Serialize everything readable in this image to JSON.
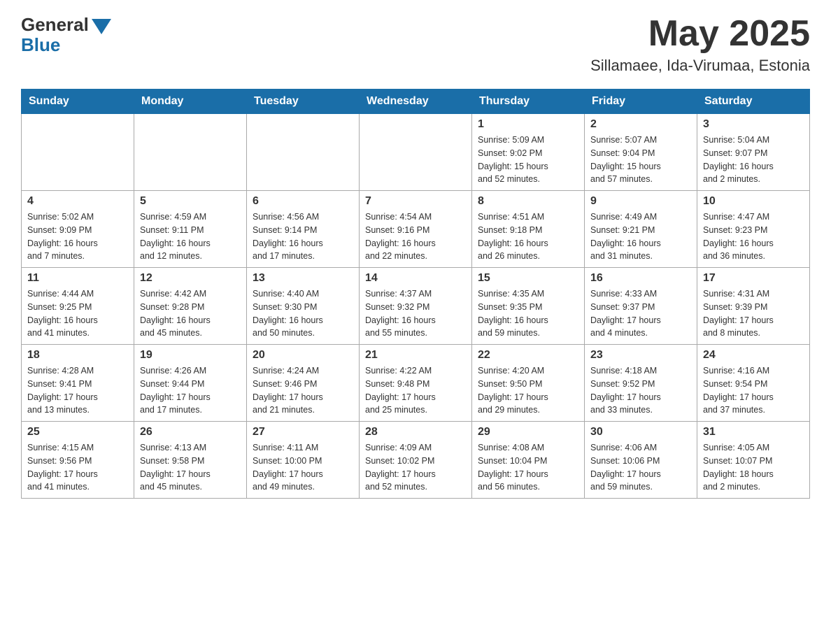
{
  "header": {
    "logo_general": "General",
    "logo_blue": "Blue",
    "month_title": "May 2025",
    "location": "Sillamaee, Ida-Virumaa, Estonia"
  },
  "calendar": {
    "days_of_week": [
      "Sunday",
      "Monday",
      "Tuesday",
      "Wednesday",
      "Thursday",
      "Friday",
      "Saturday"
    ],
    "weeks": [
      [
        {
          "day": "",
          "info": ""
        },
        {
          "day": "",
          "info": ""
        },
        {
          "day": "",
          "info": ""
        },
        {
          "day": "",
          "info": ""
        },
        {
          "day": "1",
          "info": "Sunrise: 5:09 AM\nSunset: 9:02 PM\nDaylight: 15 hours\nand 52 minutes."
        },
        {
          "day": "2",
          "info": "Sunrise: 5:07 AM\nSunset: 9:04 PM\nDaylight: 15 hours\nand 57 minutes."
        },
        {
          "day": "3",
          "info": "Sunrise: 5:04 AM\nSunset: 9:07 PM\nDaylight: 16 hours\nand 2 minutes."
        }
      ],
      [
        {
          "day": "4",
          "info": "Sunrise: 5:02 AM\nSunset: 9:09 PM\nDaylight: 16 hours\nand 7 minutes."
        },
        {
          "day": "5",
          "info": "Sunrise: 4:59 AM\nSunset: 9:11 PM\nDaylight: 16 hours\nand 12 minutes."
        },
        {
          "day": "6",
          "info": "Sunrise: 4:56 AM\nSunset: 9:14 PM\nDaylight: 16 hours\nand 17 minutes."
        },
        {
          "day": "7",
          "info": "Sunrise: 4:54 AM\nSunset: 9:16 PM\nDaylight: 16 hours\nand 22 minutes."
        },
        {
          "day": "8",
          "info": "Sunrise: 4:51 AM\nSunset: 9:18 PM\nDaylight: 16 hours\nand 26 minutes."
        },
        {
          "day": "9",
          "info": "Sunrise: 4:49 AM\nSunset: 9:21 PM\nDaylight: 16 hours\nand 31 minutes."
        },
        {
          "day": "10",
          "info": "Sunrise: 4:47 AM\nSunset: 9:23 PM\nDaylight: 16 hours\nand 36 minutes."
        }
      ],
      [
        {
          "day": "11",
          "info": "Sunrise: 4:44 AM\nSunset: 9:25 PM\nDaylight: 16 hours\nand 41 minutes."
        },
        {
          "day": "12",
          "info": "Sunrise: 4:42 AM\nSunset: 9:28 PM\nDaylight: 16 hours\nand 45 minutes."
        },
        {
          "day": "13",
          "info": "Sunrise: 4:40 AM\nSunset: 9:30 PM\nDaylight: 16 hours\nand 50 minutes."
        },
        {
          "day": "14",
          "info": "Sunrise: 4:37 AM\nSunset: 9:32 PM\nDaylight: 16 hours\nand 55 minutes."
        },
        {
          "day": "15",
          "info": "Sunrise: 4:35 AM\nSunset: 9:35 PM\nDaylight: 16 hours\nand 59 minutes."
        },
        {
          "day": "16",
          "info": "Sunrise: 4:33 AM\nSunset: 9:37 PM\nDaylight: 17 hours\nand 4 minutes."
        },
        {
          "day": "17",
          "info": "Sunrise: 4:31 AM\nSunset: 9:39 PM\nDaylight: 17 hours\nand 8 minutes."
        }
      ],
      [
        {
          "day": "18",
          "info": "Sunrise: 4:28 AM\nSunset: 9:41 PM\nDaylight: 17 hours\nand 13 minutes."
        },
        {
          "day": "19",
          "info": "Sunrise: 4:26 AM\nSunset: 9:44 PM\nDaylight: 17 hours\nand 17 minutes."
        },
        {
          "day": "20",
          "info": "Sunrise: 4:24 AM\nSunset: 9:46 PM\nDaylight: 17 hours\nand 21 minutes."
        },
        {
          "day": "21",
          "info": "Sunrise: 4:22 AM\nSunset: 9:48 PM\nDaylight: 17 hours\nand 25 minutes."
        },
        {
          "day": "22",
          "info": "Sunrise: 4:20 AM\nSunset: 9:50 PM\nDaylight: 17 hours\nand 29 minutes."
        },
        {
          "day": "23",
          "info": "Sunrise: 4:18 AM\nSunset: 9:52 PM\nDaylight: 17 hours\nand 33 minutes."
        },
        {
          "day": "24",
          "info": "Sunrise: 4:16 AM\nSunset: 9:54 PM\nDaylight: 17 hours\nand 37 minutes."
        }
      ],
      [
        {
          "day": "25",
          "info": "Sunrise: 4:15 AM\nSunset: 9:56 PM\nDaylight: 17 hours\nand 41 minutes."
        },
        {
          "day": "26",
          "info": "Sunrise: 4:13 AM\nSunset: 9:58 PM\nDaylight: 17 hours\nand 45 minutes."
        },
        {
          "day": "27",
          "info": "Sunrise: 4:11 AM\nSunset: 10:00 PM\nDaylight: 17 hours\nand 49 minutes."
        },
        {
          "day": "28",
          "info": "Sunrise: 4:09 AM\nSunset: 10:02 PM\nDaylight: 17 hours\nand 52 minutes."
        },
        {
          "day": "29",
          "info": "Sunrise: 4:08 AM\nSunset: 10:04 PM\nDaylight: 17 hours\nand 56 minutes."
        },
        {
          "day": "30",
          "info": "Sunrise: 4:06 AM\nSunset: 10:06 PM\nDaylight: 17 hours\nand 59 minutes."
        },
        {
          "day": "31",
          "info": "Sunrise: 4:05 AM\nSunset: 10:07 PM\nDaylight: 18 hours\nand 2 minutes."
        }
      ]
    ]
  }
}
